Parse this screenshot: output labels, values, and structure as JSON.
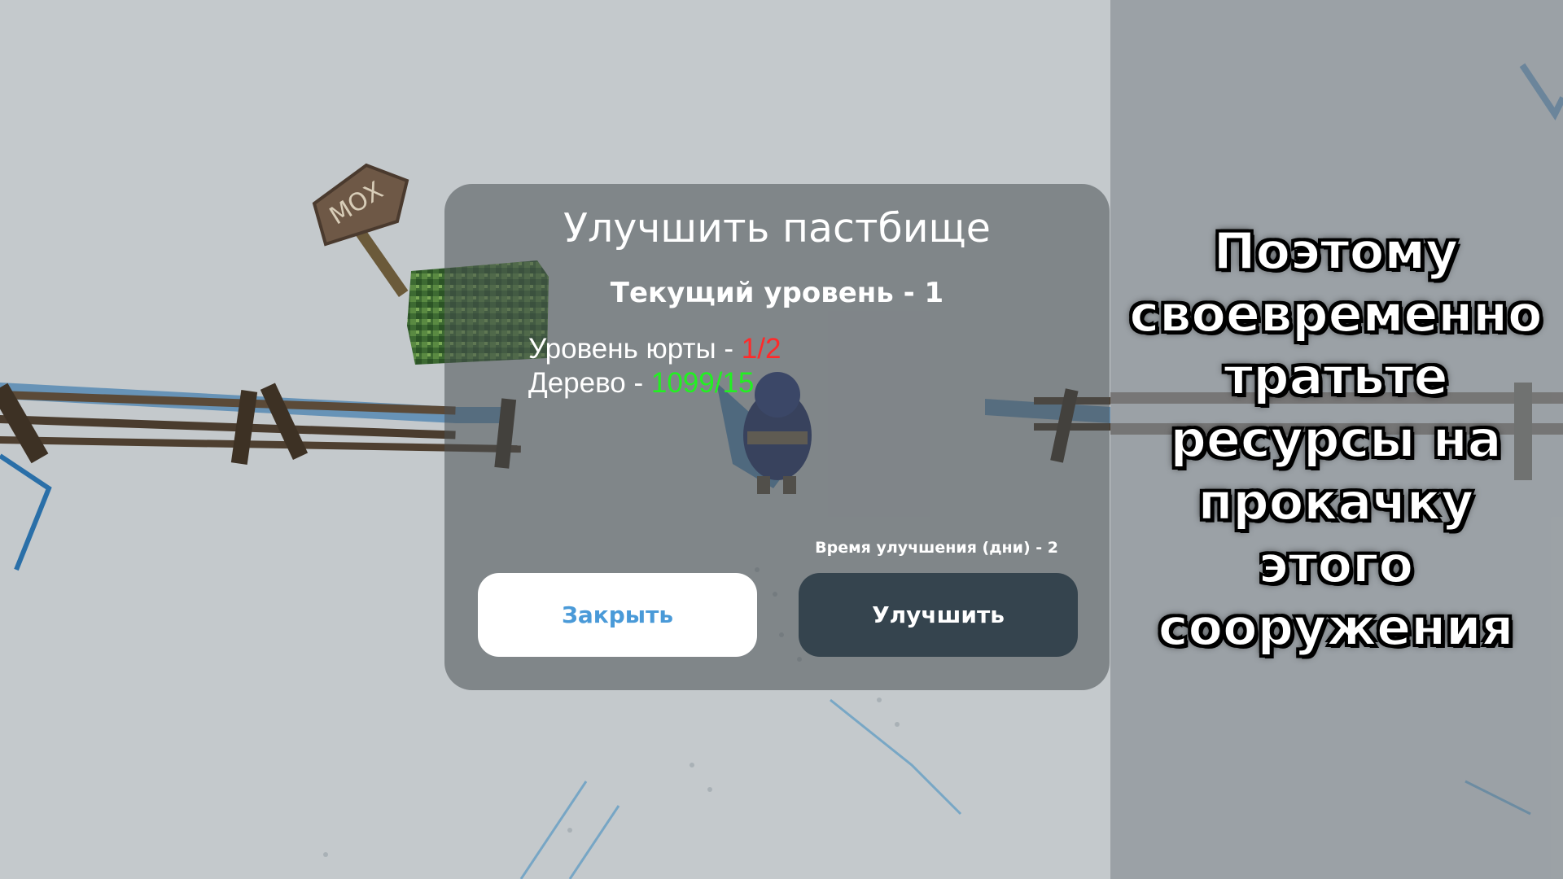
{
  "scene": {
    "sign_text": "МОХ"
  },
  "dialog": {
    "title": "Улучшить пастбище",
    "current_level_label": "Текущий уровень - 1",
    "requirements": [
      {
        "label": "Уровень юрты - ",
        "value": "1/2",
        "status_color": "#ff2a2a"
      },
      {
        "label": "Дерево - ",
        "value": "1099/15",
        "status_color": "#22f022"
      }
    ],
    "upgrade_time": "Время улучшения (дни) - 2",
    "close_label": "Закрыть",
    "upgrade_label": "Улучшить"
  },
  "caption": {
    "lines": [
      "Поэтому",
      "своевременно",
      "тратьте",
      "ресурсы на",
      "прокачку",
      "этого",
      "сооружения"
    ]
  }
}
